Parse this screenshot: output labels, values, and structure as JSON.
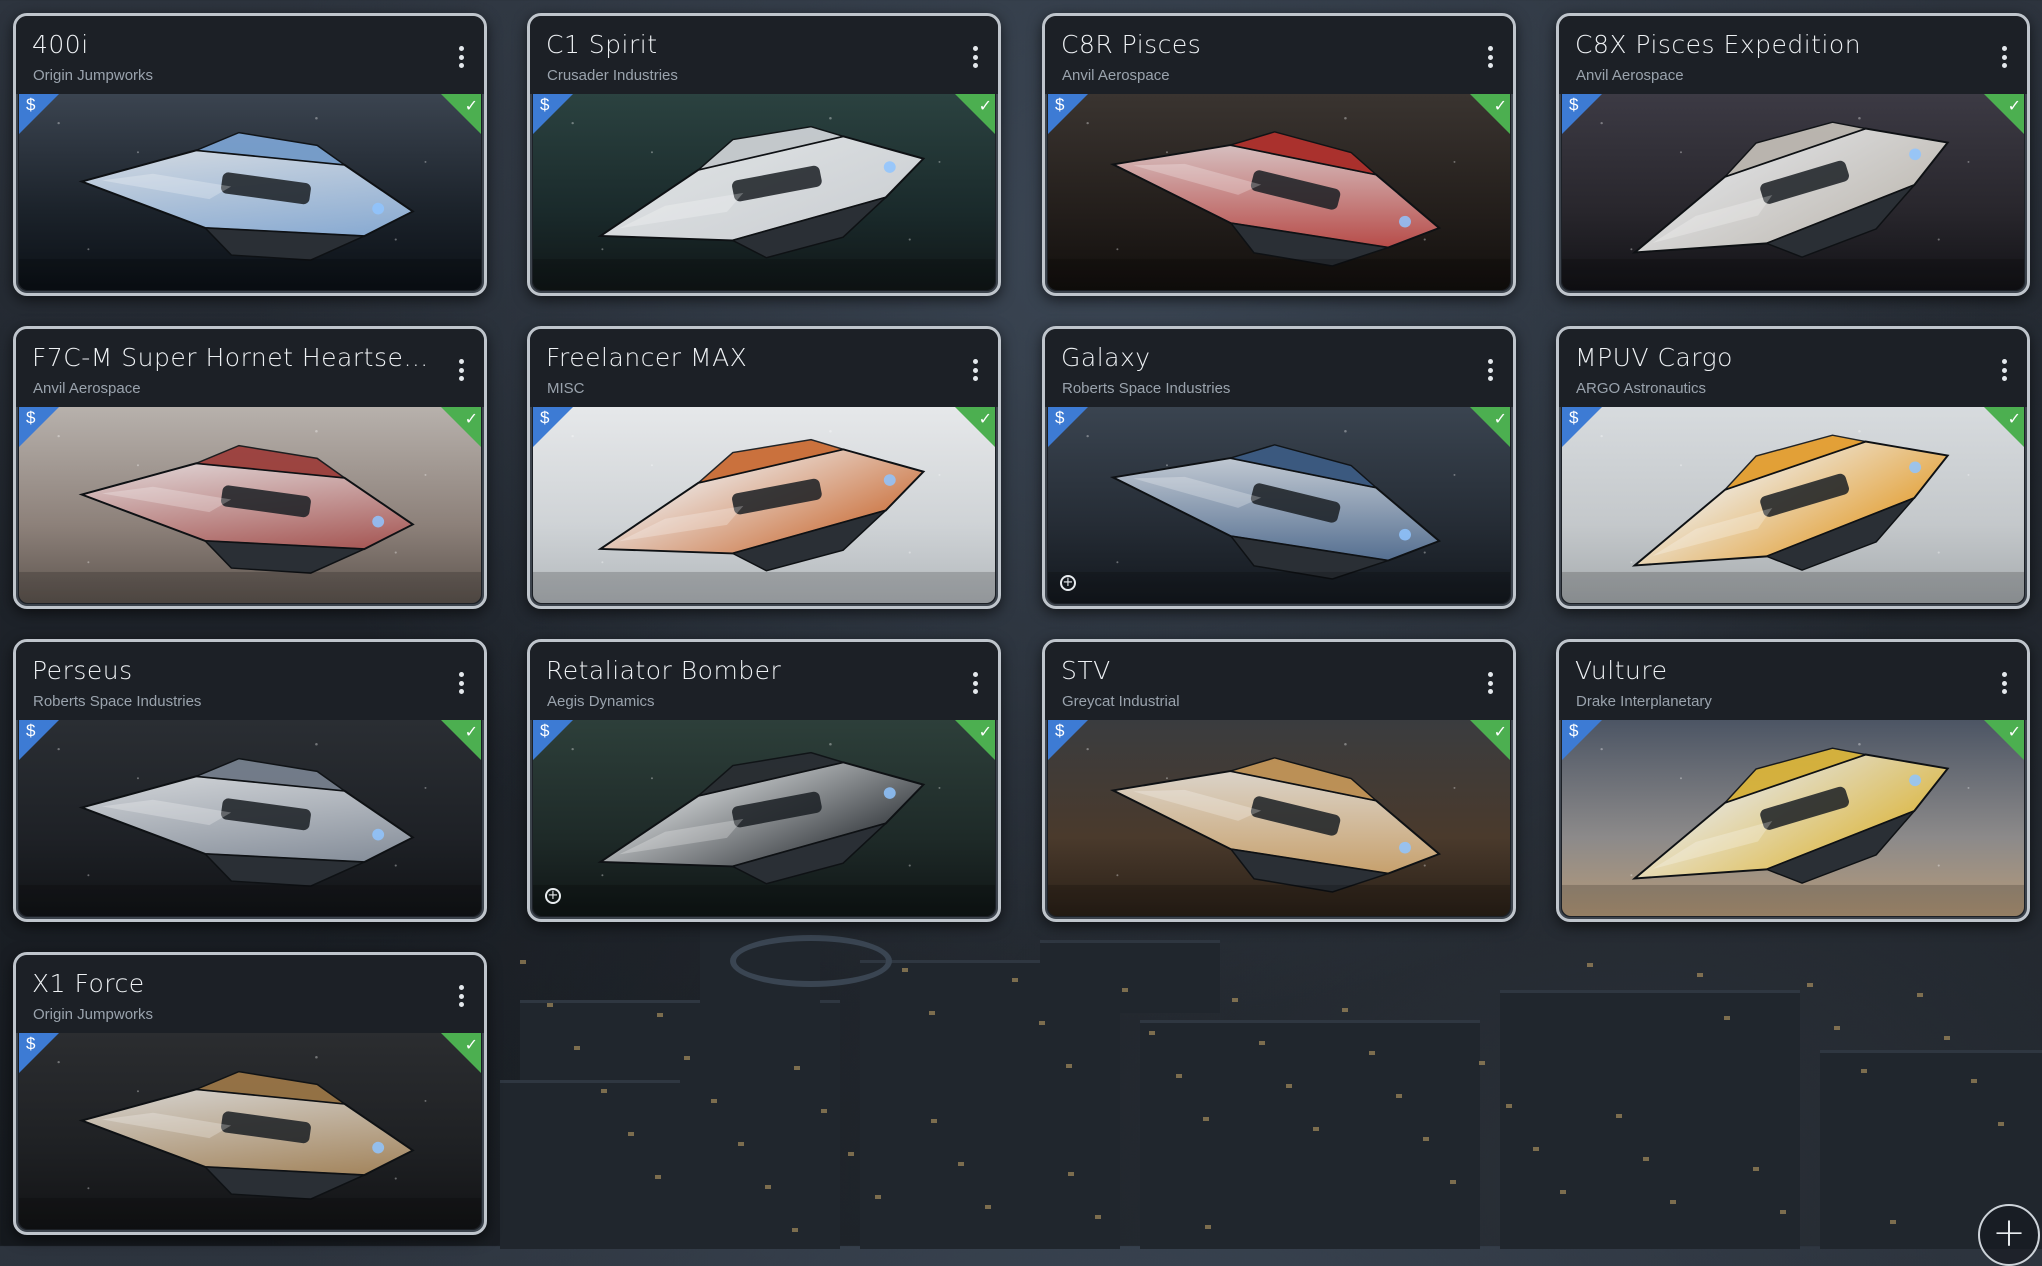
{
  "ships": [
    {
      "name": "400i",
      "manufacturer": "Origin Jumpworks",
      "price_symbol": "$",
      "owned": true,
      "add_badge": false,
      "scene": "dusk-lake",
      "accent": "#7fa8d8"
    },
    {
      "name": "C1 Spirit",
      "manufacturer": "Crusader Industries",
      "price_symbol": "$",
      "owned": true,
      "add_badge": false,
      "scene": "space-teal",
      "accent": "#d5d8dc"
    },
    {
      "name": "C8R Pisces",
      "manufacturer": "Anvil Aerospace",
      "price_symbol": "$",
      "owned": true,
      "add_badge": false,
      "scene": "cave-red",
      "accent": "#b8322e"
    },
    {
      "name": "C8X Pisces Expedition",
      "manufacturer": "Anvil Aerospace",
      "price_symbol": "$",
      "owned": true,
      "add_badge": false,
      "scene": "space-warm",
      "accent": "#c8c3bb"
    },
    {
      "name": "F7C-M Super Hornet Heartseek...",
      "manufacturer": "Anvil Aerospace",
      "price_symbol": "$",
      "owned": true,
      "add_badge": false,
      "scene": "desert-grey",
      "accent": "#9c3b38"
    },
    {
      "name": "Freelancer MAX",
      "manufacturer": "MISC",
      "price_symbol": "$",
      "owned": true,
      "add_badge": false,
      "scene": "white-studio",
      "accent": "#c9662c"
    },
    {
      "name": "Galaxy",
      "manufacturer": "Roberts Space Industries",
      "price_symbol": "$",
      "owned": true,
      "add_badge": true,
      "scene": "hangar-dark",
      "accent": "#3d5d86"
    },
    {
      "name": "MPUV Cargo",
      "manufacturer": "ARGO Astronautics",
      "price_symbol": "$",
      "owned": true,
      "add_badge": false,
      "scene": "haze-light",
      "accent": "#e59b26"
    },
    {
      "name": "Perseus",
      "manufacturer": "Roberts Space Industries",
      "price_symbol": "$",
      "owned": true,
      "add_badge": false,
      "scene": "dark-grey",
      "accent": "#7b8593"
    },
    {
      "name": "Retaliator Bomber",
      "manufacturer": "Aegis Dynamics",
      "price_symbol": "$",
      "owned": true,
      "add_badge": true,
      "scene": "space-green",
      "accent": "#2a2e33"
    },
    {
      "name": "STV",
      "manufacturer": "Greycat Industrial",
      "price_symbol": "$",
      "owned": true,
      "add_badge": false,
      "scene": "rocky-night",
      "accent": "#c99a5a"
    },
    {
      "name": "Vulture",
      "manufacturer": "Drake Interplanetary",
      "price_symbol": "$",
      "owned": true,
      "add_badge": false,
      "scene": "sky-dusk",
      "accent": "#e0b838"
    },
    {
      "name": "X1 Force",
      "manufacturer": "Origin Jumpworks",
      "price_symbol": "$",
      "owned": true,
      "add_badge": false,
      "scene": "dark-studio",
      "accent": "#a07a48"
    }
  ],
  "icons": {
    "menu": "kebab-menu-icon",
    "owned": "check-icon",
    "add": "plus-icon"
  },
  "fab_symbol": "+",
  "badge_plus": "+",
  "check_symbol": "✓",
  "colors": {
    "price_corner": "#3d7bd4",
    "owned_corner": "#4caf50",
    "card_border": "#bfc5cc"
  }
}
